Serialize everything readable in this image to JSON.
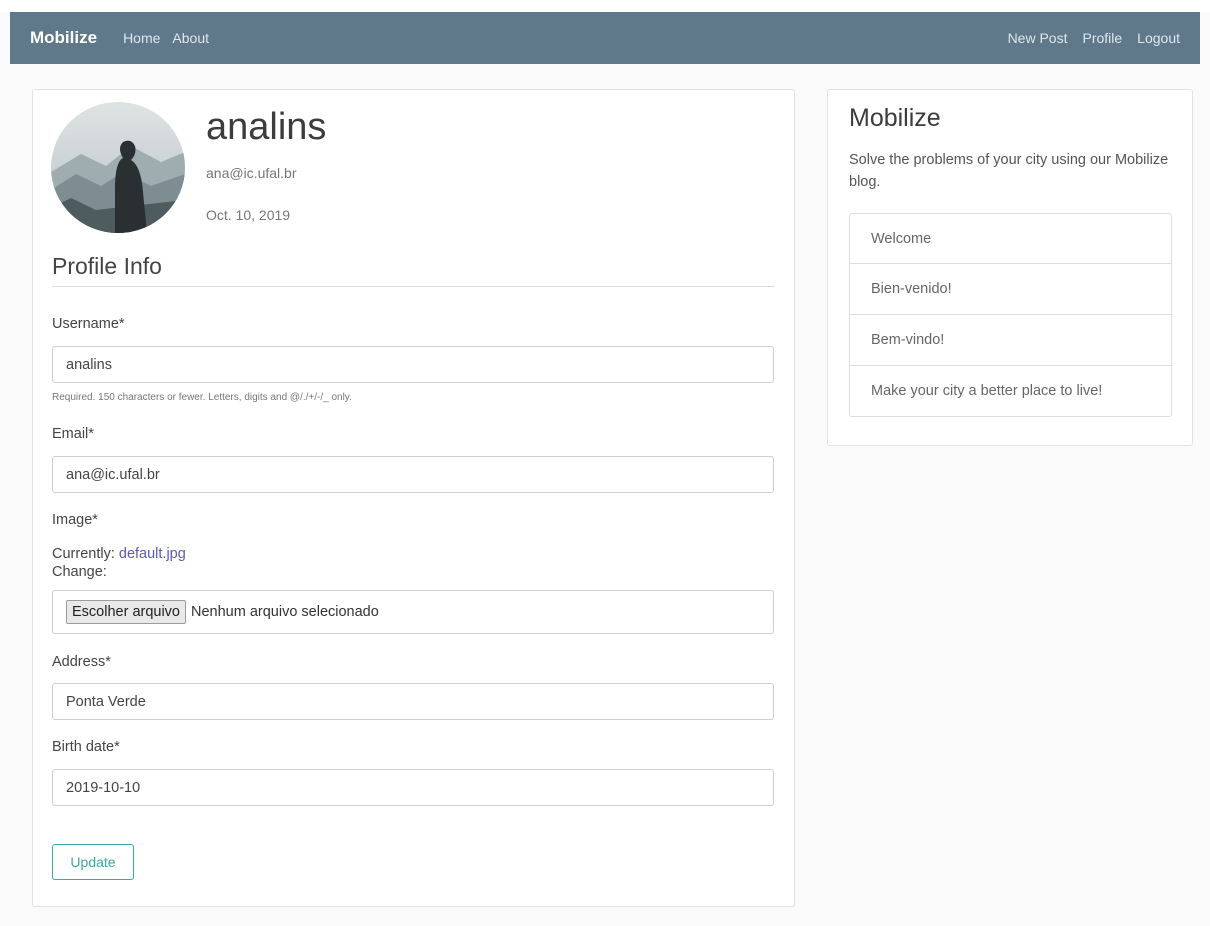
{
  "nav": {
    "brand": "Mobilize",
    "left_links": [
      "Home",
      "About"
    ],
    "right_links": [
      "New Post",
      "Profile",
      "Logout"
    ]
  },
  "profile": {
    "username": "analins",
    "email": "ana@ic.ufal.br",
    "joined": "Oct. 10, 2019"
  },
  "form": {
    "section_title": "Profile Info",
    "username_label": "Username*",
    "username_value": "analins",
    "username_help": "Required. 150 characters or fewer. Letters, digits and @/./+/-/_ only.",
    "email_label": "Email*",
    "email_value": "ana@ic.ufal.br",
    "image_label": "Image*",
    "currently_label": "Currently:",
    "current_file": "default.jpg",
    "change_label": "Change:",
    "file_button": "Escolher arquivo",
    "file_status": "Nenhum arquivo selecionado",
    "address_label": "Address*",
    "address_value": "Ponta Verde",
    "birth_label": "Birth date*",
    "birth_value": "2019-10-10",
    "submit_label": "Update"
  },
  "sidebar": {
    "title": "Mobilize",
    "description": "Solve the problems of your city using our Mobilize blog.",
    "items": [
      "Welcome",
      "Bien-venido!",
      "Bem-vindo!",
      "Make your city a better place to live!"
    ]
  },
  "colors": {
    "navbar": "#5f788a",
    "accent": "#3aa8a8",
    "link": "#5a5ab3"
  }
}
